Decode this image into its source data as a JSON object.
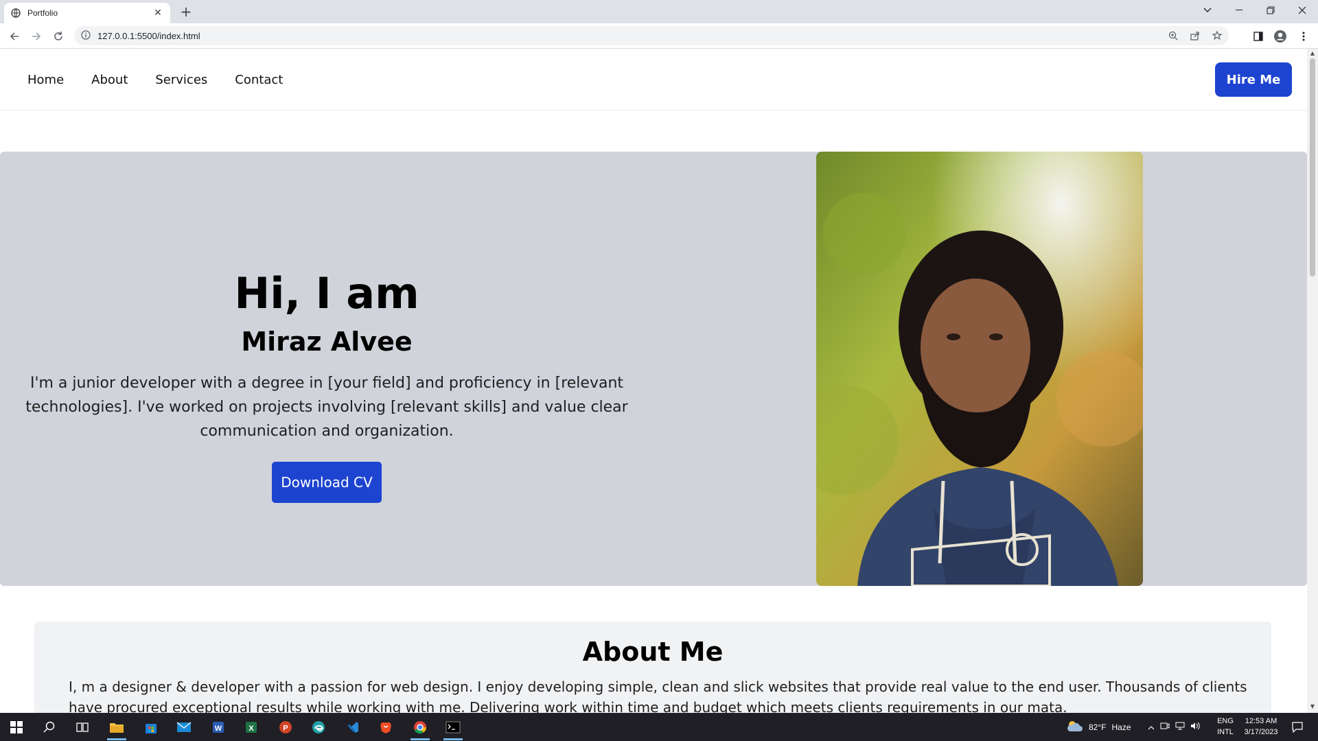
{
  "browser": {
    "tab_title": "Portfolio",
    "url": "127.0.0.1:5500/index.html"
  },
  "nav": {
    "links": [
      "Home",
      "About",
      "Services",
      "Contact"
    ],
    "hire_label": "Hire Me"
  },
  "hero": {
    "greeting": "Hi, I am",
    "name": "Miraz Alvee",
    "description": "I'm a junior developer with a degree in [your field] and proficiency in [relevant technologies]. I've worked on projects involving [relevant skills] and value clear communication and organization.",
    "cv_label": "Download CV"
  },
  "about": {
    "heading": "About Me",
    "text": "I, m a designer & developer with a passion for web design. I enjoy developing simple, clean and slick websites that provide real value to the end user. Thousands of clients have procured exceptional results while working with me. Delivering work within time and budget which meets clients requirements in our mata."
  },
  "taskbar": {
    "weather_temp": "82°F",
    "weather_desc": "Haze",
    "lang_1": "ENG",
    "lang_2": "INTL",
    "time": "12:53 AM",
    "date": "3/17/2023"
  },
  "colors": {
    "accent": "#1d44d0",
    "hero_bg": "#d1d3db",
    "about_bg": "#f1f2f4"
  }
}
